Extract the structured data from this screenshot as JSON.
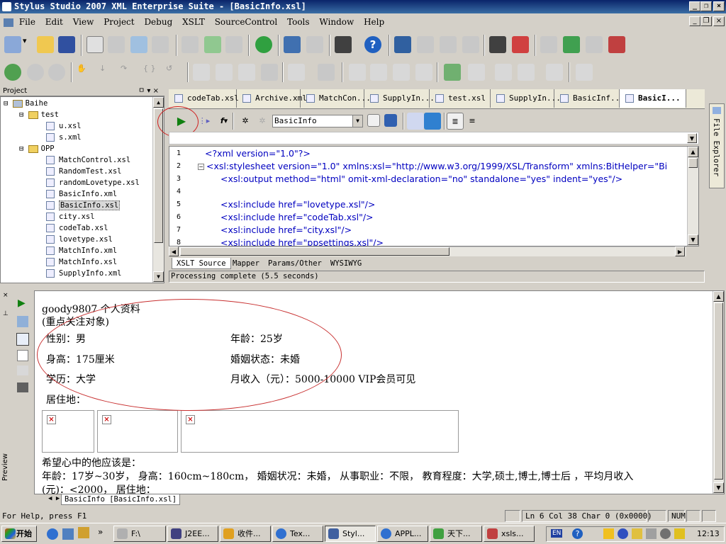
{
  "window": {
    "title": "Stylus Studio 2007 XML Enterprise Suite - [BasicInfo.xsl]"
  },
  "menu": [
    "File",
    "Edit",
    "View",
    "Project",
    "Debug",
    "XSLT",
    "SourceControl",
    "Tools",
    "Window",
    "Help"
  ],
  "project_panel": {
    "title": "Project",
    "root": "Baihe",
    "folders": [
      {
        "name": "test",
        "files": [
          "u.xsl",
          "s.xml"
        ]
      },
      {
        "name": "OPP",
        "files": [
          "MatchControl.xsl",
          "RandomTest.xsl",
          "randomLovetype.xsl",
          "BasicInfo.xml",
          "BasicInfo.xsl",
          "city.xsl",
          "codeTab.xsl",
          "lovetype.xsl",
          "MatchInfo.xml",
          "MatchInfo.xsl",
          "SupplyInfo.xml"
        ]
      }
    ]
  },
  "doc_tabs": [
    "codeTab.xsl",
    "Archive.xml",
    "MatchCon...",
    "SupplyIn...",
    "test.xsl",
    "SupplyIn...",
    "BasicInf...",
    "BasicI..."
  ],
  "editor_toolbar": {
    "template_select": "BasicInfo"
  },
  "code_lines": [
    {
      "n": "1",
      "text": "<?xml version=\"1.0\"?>"
    },
    {
      "n": "2",
      "text": "<xsl:stylesheet version=\"1.0\" xmlns:xsl=\"http://www.w3.org/1999/XSL/Transform\" xmlns:BitHelper=\"Bi"
    },
    {
      "n": "3",
      "text": "<xsl:output method=\"html\" omit-xml-declaration=\"no\" standalone=\"yes\" indent=\"yes\"/>"
    },
    {
      "n": "4",
      "text": ""
    },
    {
      "n": "5",
      "text": "<xsl:include href=\"lovetype.xsl\"/>"
    },
    {
      "n": "6",
      "text": "<xsl:include href=\"codeTab.xsl\"/>"
    },
    {
      "n": "7",
      "text": "<xsl:include href=\"city.xsl\"/>"
    },
    {
      "n": "8",
      "text": "<xsl:include href=\"ppsettings.xsl\"/>"
    }
  ],
  "bottom_tabs": [
    "XSLT Source",
    "Mapper",
    "Params/Other",
    "WYSIWYG"
  ],
  "processing": "Processing complete (5.5 seconds)",
  "side_panel": {
    "file_explorer": "File Explorer",
    "preview": "Preview"
  },
  "preview": {
    "title": "goody9807 个人资料",
    "subtitle": "(重点关注对象)",
    "gender": "性别：男",
    "age": "年龄：25岁",
    "height": "身高：175厘米",
    "marital": "婚姻状态：未婚",
    "education": "学历：大学",
    "income": "月收入（元）：5000-10000 VIP会员可见",
    "residence": "居住地：",
    "hope_title": "希望心中的他应该是：",
    "hope_line1": "年龄：17岁~30岁，  身高：160cm~180cm，  婚姻状况：未婚，  从事职业：不限，  教育程度：大学,硕士,博士,博士后 ，平均月收入",
    "hope_line2": "(元)：<2000，  居住地：",
    "tab": "BasicInfo [BasicInfo.xsl]"
  },
  "statusbar": {
    "help": "For Help, press F1",
    "position": "Ln 6 Col 38  Char 0 (0x0000)",
    "num": "NUM"
  },
  "taskbar": {
    "start": "开始",
    "tasks": [
      "F:\\",
      "J2EE...",
      "收件...",
      "Tex...",
      "Styl...",
      "APPL...",
      "天下...",
      "xsls..."
    ],
    "clock": "12:13",
    "lang": "EN"
  }
}
